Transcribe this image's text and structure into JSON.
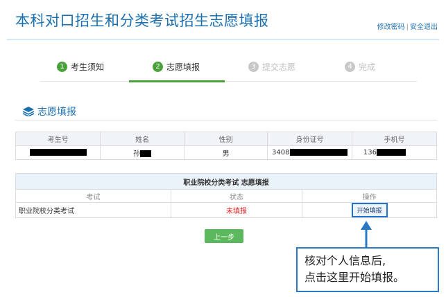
{
  "header": {
    "title": "本科对口招生和分类考试招生志愿填报",
    "change_password": "修改密码",
    "separator": "|",
    "logout": "安全退出"
  },
  "steps": [
    {
      "num": "1",
      "label": "考生须知",
      "state": "done"
    },
    {
      "num": "2",
      "label": "志愿填报",
      "state": "active"
    },
    {
      "num": "3",
      "label": "提交志愿",
      "state": "todo"
    },
    {
      "num": "4",
      "label": "完成",
      "state": "todo"
    }
  ],
  "section": {
    "title": "志愿填报",
    "icon": "layers-icon"
  },
  "student_table": {
    "headers": [
      "考生号",
      "姓名",
      "性别",
      "身份证号",
      "手机号"
    ],
    "row": {
      "exam_no": "",
      "name_prefix": "孙",
      "gender": "男",
      "id_prefix": "3408",
      "phone_prefix": "136"
    }
  },
  "exam_table": {
    "caption": "职业院校分类考试 志愿填报",
    "headers": [
      "考试",
      "状态",
      "操作"
    ],
    "rows": [
      {
        "exam": "职业院校分类考试",
        "status": "未填报",
        "action": "开始填报"
      }
    ]
  },
  "prev_button": "上一步",
  "callout": {
    "line1": "核对个人信息后,",
    "line2": "点击这里开始填报。"
  },
  "colors": {
    "brand": "#1a6fb0",
    "step_done": "#4aa33a",
    "status_red": "#e02020",
    "annotation": "#2b78c4",
    "button_green": "#5cb85c"
  }
}
